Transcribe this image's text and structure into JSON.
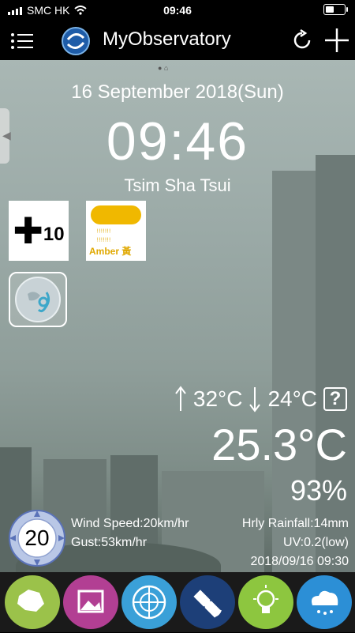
{
  "status_bar": {
    "carrier": "SMC HK",
    "time": "09:46",
    "battery_level": 0.55
  },
  "nav": {
    "title": "MyObservatory"
  },
  "weather": {
    "date": "16 September 2018(Sun)",
    "time": "09:46",
    "location": "Tsim Sha Tsui",
    "cold_warning_number": "10",
    "rain_warning_label": "Amber 黃",
    "temp_high": "32°C",
    "temp_low": "24°C",
    "help_label": "?",
    "current_temp": "25.3°C",
    "humidity": "93%",
    "wind_gauge_value": "20",
    "wind_speed": "Wind Speed:20km/hr",
    "gust": "Gust:53km/hr",
    "rainfall": "Hrly Rainfall:14mm",
    "uv": "UV:0.2(low)",
    "updated": "2018/09/16 09:30"
  },
  "dock": {
    "items": [
      {
        "icon": "map-icon",
        "color": "#9bc24a"
      },
      {
        "icon": "photo-icon",
        "color": "#b23f93"
      },
      {
        "icon": "radar-icon",
        "color": "#3aa0d8"
      },
      {
        "icon": "satellite-icon",
        "color": "#1d3f78"
      },
      {
        "icon": "lightbulb-icon",
        "color": "#8dc63f"
      },
      {
        "icon": "rain-cloud-icon",
        "color": "#2c8fd6"
      }
    ]
  }
}
